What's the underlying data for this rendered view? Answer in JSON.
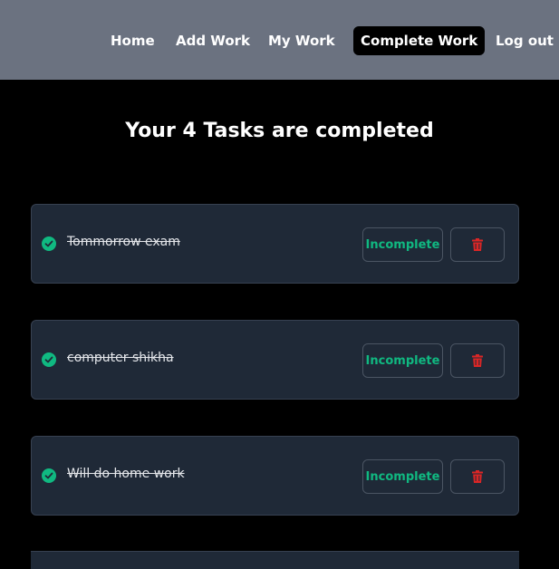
{
  "nav": {
    "items": [
      {
        "label": "Home"
      },
      {
        "label": "Add Work"
      },
      {
        "label": "My Work"
      },
      {
        "label": "Complete Work",
        "active": true
      },
      {
        "label": "Log out"
      }
    ]
  },
  "page": {
    "heading": "Your 4 Tasks are completed"
  },
  "tasks": [
    {
      "text": "Tommorrow exam",
      "status_icon": "check-circle-icon",
      "action_label": "Incomplete",
      "delete_icon": "trash-icon"
    },
    {
      "text": "computer shikha",
      "status_icon": "check-circle-icon",
      "action_label": "Incomplete",
      "delete_icon": "trash-icon"
    },
    {
      "text": "Will do home work",
      "status_icon": "check-circle-icon",
      "action_label": "Incomplete",
      "delete_icon": "trash-icon"
    }
  ],
  "colors": {
    "navbar_bg": "#6b7280",
    "page_bg": "#000000",
    "card_bg": "#1f2937",
    "accent_green": "#10b981",
    "delete_red": "#dc2626"
  }
}
